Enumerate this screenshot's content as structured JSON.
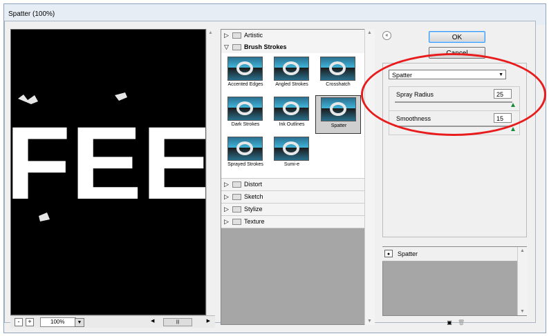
{
  "window": {
    "title": "Spatter (100%)"
  },
  "preview": {
    "zoom": "100%",
    "zoom_minus": "-",
    "zoom_plus": "+"
  },
  "filters": {
    "categories_top": [
      {
        "label": "Artistic",
        "expanded": false
      },
      {
        "label": "Brush Strokes",
        "expanded": true
      }
    ],
    "brush_strokes": [
      {
        "label": "Accented Edges"
      },
      {
        "label": "Angled Strokes"
      },
      {
        "label": "Crosshatch"
      },
      {
        "label": "Dark Strokes"
      },
      {
        "label": "Ink Outlines"
      },
      {
        "label": "Spatter",
        "selected": true
      },
      {
        "label": "Sprayed Strokes"
      },
      {
        "label": "Sumi-e"
      }
    ],
    "categories_bottom": [
      {
        "label": "Distort"
      },
      {
        "label": "Sketch"
      },
      {
        "label": "Stylize"
      },
      {
        "label": "Texture"
      }
    ]
  },
  "buttons": {
    "ok": "OK",
    "cancel": "Cancel"
  },
  "settings": {
    "filter_select": "Spatter",
    "params": [
      {
        "label": "Spray Radius",
        "value": "25"
      },
      {
        "label": "Smoothness",
        "value": "15"
      }
    ]
  },
  "effect_layers": [
    {
      "label": "Spatter"
    }
  ],
  "preview_image_text": "FEE",
  "colors": {
    "annotation_ellipse": "#e81c1c",
    "ok_border": "#3399ff"
  }
}
